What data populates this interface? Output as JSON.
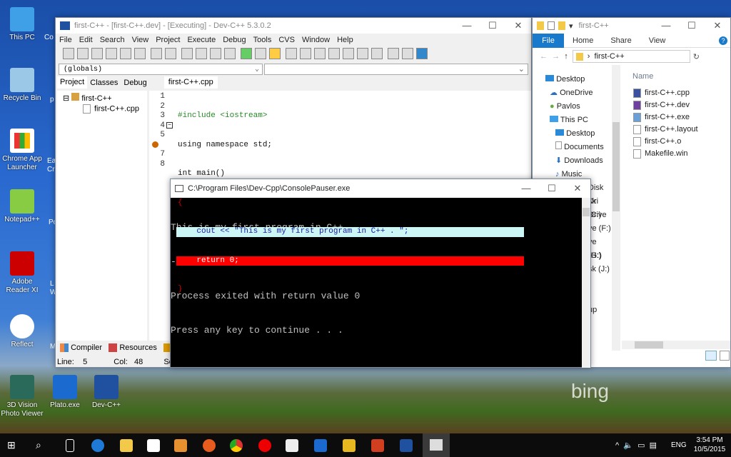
{
  "desktop": {
    "icons": [
      "This PC",
      "Recycle Bin",
      "Chrome App Launcher",
      "Notepad++",
      "Adobe Reader XI",
      "Reflect",
      "3D Vision Photo Viewer",
      "Plato.exe",
      "Dev-C++"
    ],
    "partial_icons": [
      "Co",
      "p",
      "Ea",
      "Cr",
      "Po",
      "L",
      "W",
      "M"
    ],
    "wallpaper_logo": "bing"
  },
  "devcpp": {
    "title": "first-C++ - [first-C++.dev] - [Executing] - Dev-C++ 5.3.0.2",
    "menu": [
      "File",
      "Edit",
      "Search",
      "View",
      "Project",
      "Execute",
      "Debug",
      "Tools",
      "CVS",
      "Window",
      "Help"
    ],
    "scope_combo": "(globals)",
    "left_tabs": [
      "Project",
      "Classes",
      "Debug"
    ],
    "editor_tab": "first-C++.cpp",
    "tree": {
      "project": "first-C++",
      "file": "first-C++.cpp"
    },
    "code": [
      "#include <iostream>",
      "using namespace std;",
      "int main()",
      "{",
      "    cout << \"This is my first program in C++ . \";",
      "    return 0;",
      "}",
      ""
    ],
    "bottom_tabs": [
      "Compiler",
      "Resources"
    ],
    "status": {
      "line_label": "Line:",
      "line": "5",
      "col_label": "Col:",
      "col": "48",
      "sel_label": "Sel:"
    },
    "colors": {
      "current_line": "#ccf5f5",
      "breakpoint_line": "#ff0000"
    }
  },
  "console": {
    "title": "C:\\Program Files\\Dev-Cpp\\ConsolePauser.exe",
    "lines": [
      "This is my first program in C++ .",
      "--------------------------------",
      "Process exited with return value 0",
      "Press any key to continue . . ."
    ]
  },
  "explorer": {
    "title": "first-C++",
    "ribbon": [
      "File",
      "Home",
      "Share",
      "View"
    ],
    "address": "first-C++",
    "nav": [
      "Desktop",
      "OneDrive",
      "Pavlos",
      "This PC",
      "Desktop",
      "Documents",
      "Downloads",
      "Music"
    ],
    "nav_partial": [
      "Disk Dri",
      "sk (C:)",
      "Drive",
      "ve (F:)",
      "ve (G:)",
      "(H:)",
      "sk (J:)",
      "up"
    ],
    "column": "Name",
    "files": [
      "first-C++.cpp",
      "first-C++.dev",
      "first-C++.exe",
      "first-C++.layout",
      "first-C++.o",
      "Makefile.win"
    ]
  },
  "taskbar": {
    "time": "3:54 PM",
    "date": "10/5/2015",
    "lang": "ENG"
  }
}
